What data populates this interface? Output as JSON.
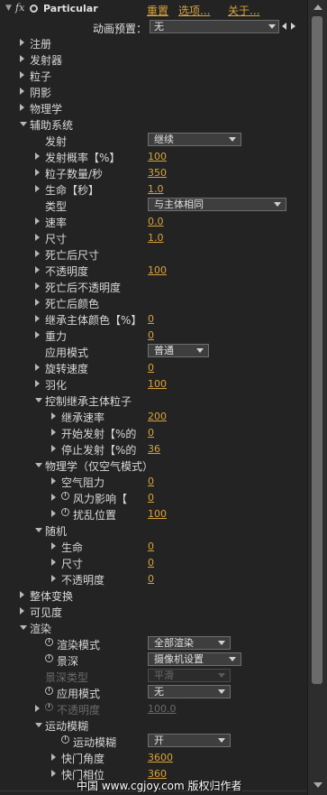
{
  "header": {
    "twisty": "▼",
    "fx": "fx",
    "effect_name": "Particular",
    "reset": "重置",
    "options": "选项...",
    "about": "关于..."
  },
  "preset": {
    "label": "动画预置：",
    "value": "无"
  },
  "rows": [
    {
      "depth": 1,
      "twisty": "closed",
      "label": "注册"
    },
    {
      "depth": 1,
      "twisty": "closed",
      "label": "发射器"
    },
    {
      "depth": 1,
      "twisty": "closed",
      "label": "粒子"
    },
    {
      "depth": 1,
      "twisty": "closed",
      "label": "阴影"
    },
    {
      "depth": 1,
      "twisty": "closed",
      "label": "物理学"
    },
    {
      "depth": 1,
      "twisty": "open",
      "label": "辅助系统"
    },
    {
      "depth": 2,
      "label": "发射",
      "select": "继续",
      "selw": 96
    },
    {
      "depth": 2,
      "twisty": "closed",
      "label": "发射概率【%】",
      "value": "100"
    },
    {
      "depth": 2,
      "twisty": "closed",
      "label": "粒子数量/秒",
      "value": "350"
    },
    {
      "depth": 2,
      "twisty": "closed",
      "label": "生命【秒】",
      "value": "1.0"
    },
    {
      "depth": 2,
      "label": "类型",
      "select": "与主体相同",
      "selw": 146
    },
    {
      "depth": 2,
      "twisty": "closed",
      "label": "速率",
      "value": "0.0"
    },
    {
      "depth": 2,
      "twisty": "closed",
      "label": "尺寸",
      "value": "1.0"
    },
    {
      "depth": 2,
      "twisty": "closed",
      "label": "死亡后尺寸"
    },
    {
      "depth": 2,
      "twisty": "closed",
      "label": "不透明度",
      "value": "100"
    },
    {
      "depth": 2,
      "twisty": "closed",
      "label": "死亡后不透明度"
    },
    {
      "depth": 2,
      "twisty": "closed",
      "label": "死亡后颜色"
    },
    {
      "depth": 2,
      "twisty": "closed",
      "label": "继承主体颜色【%】",
      "value": "0"
    },
    {
      "depth": 2,
      "twisty": "closed",
      "label": "重力",
      "value": "0"
    },
    {
      "depth": 2,
      "label": "应用模式",
      "select": "普通",
      "selw": 60
    },
    {
      "depth": 2,
      "twisty": "closed",
      "label": "旋转速度",
      "value": "0"
    },
    {
      "depth": 2,
      "twisty": "closed",
      "label": "羽化",
      "value": "100"
    },
    {
      "depth": 2,
      "twisty": "open",
      "label": "控制继承主体粒子"
    },
    {
      "depth": 3,
      "twisty": "closed",
      "label": "继承速率",
      "value": "200"
    },
    {
      "depth": 3,
      "twisty": "closed",
      "label": "开始发射【%的",
      "value": "0"
    },
    {
      "depth": 3,
      "twisty": "closed",
      "label": "停止发射【%的",
      "value": "36"
    },
    {
      "depth": 2,
      "twisty": "open",
      "label": "物理学（仅空气模式）"
    },
    {
      "depth": 3,
      "twisty": "closed",
      "label": "空气阻力",
      "value": "0"
    },
    {
      "depth": 3,
      "twisty": "closed",
      "stopwatch": true,
      "label": "风力影响【",
      "value": "0"
    },
    {
      "depth": 3,
      "twisty": "closed",
      "stopwatch": true,
      "label": "扰乱位置",
      "value": "100"
    },
    {
      "depth": 2,
      "twisty": "open",
      "label": "随机"
    },
    {
      "depth": 3,
      "twisty": "closed",
      "label": "生命",
      "value": "0"
    },
    {
      "depth": 3,
      "twisty": "closed",
      "label": "尺寸",
      "value": "0"
    },
    {
      "depth": 3,
      "twisty": "closed",
      "label": "不透明度",
      "value": "0"
    },
    {
      "depth": 1,
      "twisty": "closed",
      "label": "整体变换"
    },
    {
      "depth": 1,
      "twisty": "closed",
      "label": "可见度"
    },
    {
      "depth": 1,
      "twisty": "open",
      "label": "渲染"
    },
    {
      "depth": 2,
      "stopwatch": true,
      "label": "渲染模式",
      "select": "全部渲染",
      "selw": 84
    },
    {
      "depth": 2,
      "stopwatch": true,
      "label": "景深",
      "select": "摄像机设置",
      "selw": 96
    },
    {
      "depth": 2,
      "label": "景深类型",
      "select": "平滑",
      "selw": 84,
      "disabled": true
    },
    {
      "depth": 2,
      "stopwatch": true,
      "label": "应用模式",
      "select": "无",
      "selw": 84
    },
    {
      "depth": 2,
      "twisty": "closed",
      "stopwatch": true,
      "label": "不透明度",
      "value": "100.0",
      "disabled": true
    },
    {
      "depth": 2,
      "twisty": "open",
      "label": "运动模糊"
    },
    {
      "depth": 3,
      "stopwatch": true,
      "label": "运动模糊",
      "select": "开",
      "selw": 84
    },
    {
      "depth": 3,
      "twisty": "closed",
      "label": "快门角度",
      "value": "3600"
    },
    {
      "depth": 3,
      "twisty": "closed",
      "label": "快门相位",
      "value": "360"
    }
  ],
  "watermark": "中国 www.cgjoy.com 版权归作者"
}
